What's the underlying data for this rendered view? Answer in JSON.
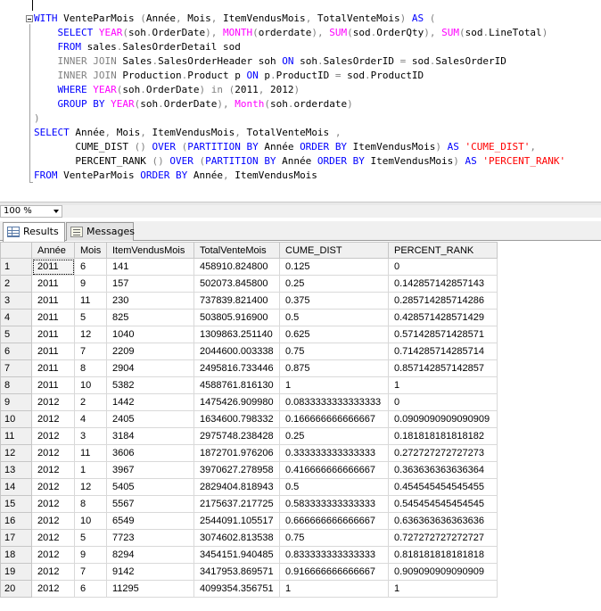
{
  "editor": {
    "lines": [
      [
        [
          "kw",
          "WITH"
        ],
        [
          "t",
          " VenteParMois "
        ],
        [
          "gr",
          "("
        ],
        [
          "t",
          "Année"
        ],
        [
          "gr",
          ","
        ],
        [
          "t",
          " Mois"
        ],
        [
          "gr",
          ","
        ],
        [
          "t",
          " ItemVendusMois"
        ],
        [
          "gr",
          ","
        ],
        [
          "t",
          " TotalVenteMois"
        ],
        [
          "gr",
          ")"
        ],
        [
          "t",
          " "
        ],
        [
          "kw",
          "AS"
        ],
        [
          "t",
          " "
        ],
        [
          "gr",
          "("
        ]
      ],
      [
        [
          "t",
          "    "
        ],
        [
          "kw",
          "SELECT"
        ],
        [
          "t",
          " "
        ],
        [
          "fn",
          "YEAR"
        ],
        [
          "gr",
          "("
        ],
        [
          "t",
          "soh"
        ],
        [
          "gr",
          "."
        ],
        [
          "t",
          "OrderDate"
        ],
        [
          "gr",
          ")"
        ],
        [
          "gr",
          ","
        ],
        [
          "t",
          " "
        ],
        [
          "fn",
          "MONTH"
        ],
        [
          "gr",
          "("
        ],
        [
          "t",
          "orderdate"
        ],
        [
          "gr",
          ")"
        ],
        [
          "gr",
          ","
        ],
        [
          "t",
          " "
        ],
        [
          "fn",
          "SUM"
        ],
        [
          "gr",
          "("
        ],
        [
          "t",
          "sod"
        ],
        [
          "gr",
          "."
        ],
        [
          "t",
          "OrderQty"
        ],
        [
          "gr",
          ")"
        ],
        [
          "gr",
          ","
        ],
        [
          "t",
          " "
        ],
        [
          "fn",
          "SUM"
        ],
        [
          "gr",
          "("
        ],
        [
          "t",
          "sod"
        ],
        [
          "gr",
          "."
        ],
        [
          "t",
          "LineTotal"
        ],
        [
          "gr",
          ")"
        ]
      ],
      [
        [
          "t",
          "    "
        ],
        [
          "kw",
          "FROM"
        ],
        [
          "t",
          " sales"
        ],
        [
          "gr",
          "."
        ],
        [
          "t",
          "SalesOrderDetail sod"
        ]
      ],
      [
        [
          "t",
          "    "
        ],
        [
          "gr",
          "INNER"
        ],
        [
          "t",
          " "
        ],
        [
          "gr",
          "JOIN"
        ],
        [
          "t",
          " Sales"
        ],
        [
          "gr",
          "."
        ],
        [
          "t",
          "SalesOrderHeader soh "
        ],
        [
          "kw",
          "ON"
        ],
        [
          "t",
          " soh"
        ],
        [
          "gr",
          "."
        ],
        [
          "t",
          "SalesOrderID "
        ],
        [
          "gr",
          "="
        ],
        [
          "t",
          " sod"
        ],
        [
          "gr",
          "."
        ],
        [
          "t",
          "SalesOrderID"
        ]
      ],
      [
        [
          "t",
          "    "
        ],
        [
          "gr",
          "INNER"
        ],
        [
          "t",
          " "
        ],
        [
          "gr",
          "JOIN"
        ],
        [
          "t",
          " Production"
        ],
        [
          "gr",
          "."
        ],
        [
          "t",
          "Product p "
        ],
        [
          "kw",
          "ON"
        ],
        [
          "t",
          " p"
        ],
        [
          "gr",
          "."
        ],
        [
          "t",
          "ProductID "
        ],
        [
          "gr",
          "="
        ],
        [
          "t",
          " sod"
        ],
        [
          "gr",
          "."
        ],
        [
          "t",
          "ProductID"
        ]
      ],
      [
        [
          "t",
          "    "
        ],
        [
          "kw",
          "WHERE"
        ],
        [
          "t",
          " "
        ],
        [
          "fn",
          "YEAR"
        ],
        [
          "gr",
          "("
        ],
        [
          "t",
          "soh"
        ],
        [
          "gr",
          "."
        ],
        [
          "t",
          "OrderDate"
        ],
        [
          "gr",
          ")"
        ],
        [
          "t",
          " "
        ],
        [
          "gr",
          "in"
        ],
        [
          "t",
          " "
        ],
        [
          "gr",
          "("
        ],
        [
          "t",
          "2011"
        ],
        [
          "gr",
          ","
        ],
        [
          "t",
          " 2012"
        ],
        [
          "gr",
          ")"
        ]
      ],
      [
        [
          "t",
          "    "
        ],
        [
          "kw",
          "GROUP"
        ],
        [
          "t",
          " "
        ],
        [
          "kw",
          "BY"
        ],
        [
          "t",
          " "
        ],
        [
          "fn",
          "YEAR"
        ],
        [
          "gr",
          "("
        ],
        [
          "t",
          "soh"
        ],
        [
          "gr",
          "."
        ],
        [
          "t",
          "OrderDate"
        ],
        [
          "gr",
          ")"
        ],
        [
          "gr",
          ","
        ],
        [
          "t",
          " "
        ],
        [
          "fn",
          "Month"
        ],
        [
          "gr",
          "("
        ],
        [
          "t",
          "soh"
        ],
        [
          "gr",
          "."
        ],
        [
          "t",
          "orderdate"
        ],
        [
          "gr",
          ")"
        ]
      ],
      [
        [
          "gr",
          ")"
        ]
      ],
      [
        [
          "kw",
          "SELECT"
        ],
        [
          "t",
          " Année"
        ],
        [
          "gr",
          ","
        ],
        [
          "t",
          " Mois"
        ],
        [
          "gr",
          ","
        ],
        [
          "t",
          " ItemVendusMois"
        ],
        [
          "gr",
          ","
        ],
        [
          "t",
          " TotalVenteMois "
        ],
        [
          "gr",
          ","
        ]
      ],
      [
        [
          "t",
          "       CUME_DIST "
        ],
        [
          "gr",
          "("
        ],
        [
          "gr",
          ")"
        ],
        [
          "t",
          " "
        ],
        [
          "kw",
          "OVER"
        ],
        [
          "t",
          " "
        ],
        [
          "gr",
          "("
        ],
        [
          "kw",
          "PARTITION"
        ],
        [
          "t",
          " "
        ],
        [
          "kw",
          "BY"
        ],
        [
          "t",
          " Année "
        ],
        [
          "kw",
          "ORDER"
        ],
        [
          "t",
          " "
        ],
        [
          "kw",
          "BY"
        ],
        [
          "t",
          " ItemVendusMois"
        ],
        [
          "gr",
          ")"
        ],
        [
          "t",
          " "
        ],
        [
          "kw",
          "AS"
        ],
        [
          "t",
          " "
        ],
        [
          "st",
          "'CUME_DIST'"
        ],
        [
          "gr",
          ","
        ]
      ],
      [
        [
          "t",
          "       PERCENT_RANK "
        ],
        [
          "gr",
          "("
        ],
        [
          "gr",
          ")"
        ],
        [
          "t",
          " "
        ],
        [
          "kw",
          "OVER"
        ],
        [
          "t",
          " "
        ],
        [
          "gr",
          "("
        ],
        [
          "kw",
          "PARTITION"
        ],
        [
          "t",
          " "
        ],
        [
          "kw",
          "BY"
        ],
        [
          "t",
          " Année "
        ],
        [
          "kw",
          "ORDER"
        ],
        [
          "t",
          " "
        ],
        [
          "kw",
          "BY"
        ],
        [
          "t",
          " ItemVendusMois"
        ],
        [
          "gr",
          ")"
        ],
        [
          "t",
          " "
        ],
        [
          "kw",
          "AS"
        ],
        [
          "t",
          " "
        ],
        [
          "st",
          "'PERCENT_RANK'"
        ]
      ],
      [
        [
          "kw",
          "FROM"
        ],
        [
          "t",
          " VenteParMois "
        ],
        [
          "kw",
          "ORDER"
        ],
        [
          "t",
          " "
        ],
        [
          "kw",
          "BY"
        ],
        [
          "t",
          " Année"
        ],
        [
          "gr",
          ","
        ],
        [
          "t",
          " ItemVendusMois"
        ]
      ]
    ]
  },
  "zoom": {
    "value": "100 %"
  },
  "tabs": [
    {
      "label": "Results",
      "active": true,
      "icon": "grid-icon"
    },
    {
      "label": "Messages",
      "active": false,
      "icon": "messages-icon"
    }
  ],
  "grid": {
    "columns": [
      "Année",
      "Mois",
      "ItemVendusMois",
      "TotalVenteMois",
      "CUME_DIST",
      "PERCENT_RANK"
    ],
    "rows": [
      [
        "1",
        "2011",
        "6",
        "141",
        "458910.824800",
        "0.125",
        "0"
      ],
      [
        "2",
        "2011",
        "9",
        "157",
        "502073.845800",
        "0.25",
        "0.142857142857143"
      ],
      [
        "3",
        "2011",
        "11",
        "230",
        "737839.821400",
        "0.375",
        "0.285714285714286"
      ],
      [
        "4",
        "2011",
        "5",
        "825",
        "503805.916900",
        "0.5",
        "0.428571428571429"
      ],
      [
        "5",
        "2011",
        "12",
        "1040",
        "1309863.251140",
        "0.625",
        "0.571428571428571"
      ],
      [
        "6",
        "2011",
        "7",
        "2209",
        "2044600.003338",
        "0.75",
        "0.714285714285714"
      ],
      [
        "7",
        "2011",
        "8",
        "2904",
        "2495816.733446",
        "0.875",
        "0.857142857142857"
      ],
      [
        "8",
        "2011",
        "10",
        "5382",
        "4588761.816130",
        "1",
        "1"
      ],
      [
        "9",
        "2012",
        "2",
        "1442",
        "1475426.909980",
        "0.0833333333333333",
        "0"
      ],
      [
        "10",
        "2012",
        "4",
        "2405",
        "1634600.798332",
        "0.166666666666667",
        "0.0909090909090909"
      ],
      [
        "11",
        "2012",
        "3",
        "3184",
        "2975748.238428",
        "0.25",
        "0.181818181818182"
      ],
      [
        "12",
        "2012",
        "11",
        "3606",
        "1872701.976206",
        "0.333333333333333",
        "0.272727272727273"
      ],
      [
        "13",
        "2012",
        "1",
        "3967",
        "3970627.278958",
        "0.416666666666667",
        "0.363636363636364"
      ],
      [
        "14",
        "2012",
        "12",
        "5405",
        "2829404.818943",
        "0.5",
        "0.454545454545455"
      ],
      [
        "15",
        "2012",
        "8",
        "5567",
        "2175637.217725",
        "0.583333333333333",
        "0.545454545454545"
      ],
      [
        "16",
        "2012",
        "10",
        "6549",
        "2544091.105517",
        "0.666666666666667",
        "0.636363636363636"
      ],
      [
        "17",
        "2012",
        "5",
        "7723",
        "3074602.813538",
        "0.75",
        "0.727272727272727"
      ],
      [
        "18",
        "2012",
        "9",
        "8294",
        "3454151.940485",
        "0.833333333333333",
        "0.818181818181818"
      ],
      [
        "19",
        "2012",
        "7",
        "9142",
        "3417953.869571",
        "0.916666666666667",
        "0.909090909090909"
      ],
      [
        "20",
        "2012",
        "6",
        "11295",
        "4099354.356751",
        "1",
        "1"
      ]
    ]
  }
}
